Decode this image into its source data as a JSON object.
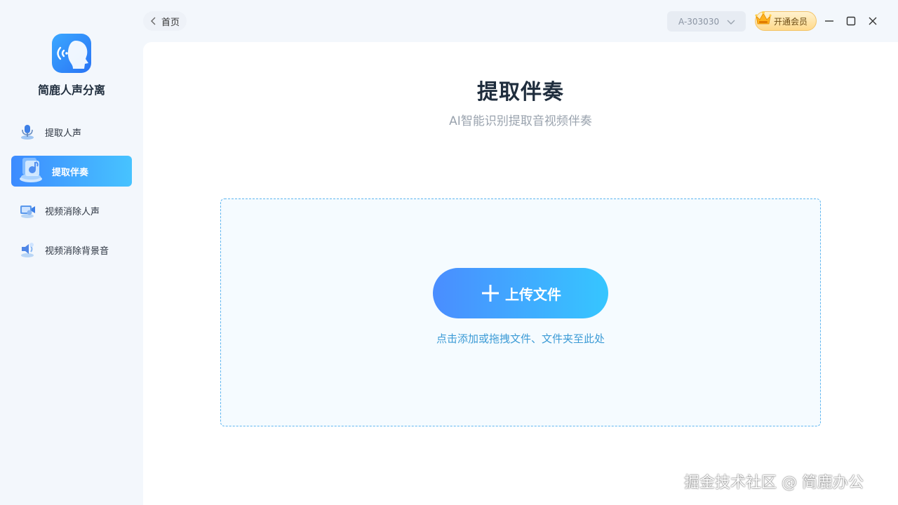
{
  "app": {
    "name": "简鹿人声分离",
    "accent": "#3d8bff"
  },
  "sidebar": {
    "items": [
      {
        "label": "提取人声",
        "icon": "microphone-icon",
        "active": false
      },
      {
        "label": "提取伴奏",
        "icon": "accompaniment-icon",
        "active": true
      },
      {
        "label": "视频消除人声",
        "icon": "video-voice-remove-icon",
        "active": false
      },
      {
        "label": "视频消除背景音",
        "icon": "video-bgm-remove-icon",
        "active": false
      }
    ]
  },
  "topbar": {
    "back_label": "首页",
    "account_id": "A-303030",
    "vip_label": "开通会员"
  },
  "main": {
    "title": "提取伴奏",
    "subtitle": "AI智能识别提取音视频伴奏",
    "upload_label": "上传文件",
    "hint": "点击添加或拖拽文件、文件夹至此处"
  },
  "watermark": "掘金技术社区 @ 简鹿办公"
}
